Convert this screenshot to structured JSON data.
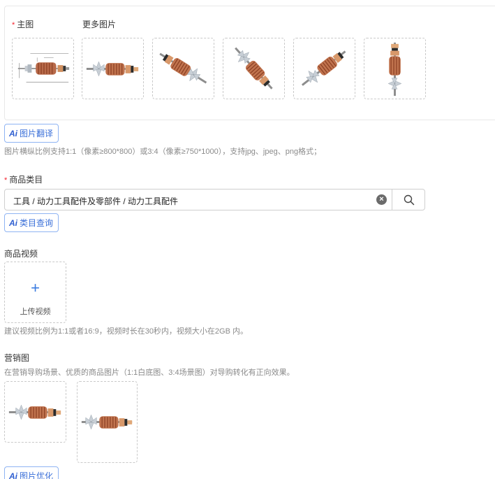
{
  "main_images": {
    "main_label": "主图",
    "required_mark": "*",
    "more_label": "更多图片",
    "thumbnails": [
      {
        "icon": "armature-diagram-image"
      },
      {
        "icon": "armature-side-image"
      },
      {
        "icon": "armature-tilted-image"
      },
      {
        "icon": "armature-diagonal-image"
      },
      {
        "icon": "armature-angled-image"
      },
      {
        "icon": "armature-vertical-image"
      }
    ]
  },
  "ai_translate": {
    "badge": "Ai",
    "label": "图片翻译"
  },
  "image_hint": "图片横纵比例支持1:1（像素≥800*800）或3:4（像素≥750*1000），支持jpg、jpeg、png格式；",
  "category": {
    "required_mark": "*",
    "label": "商品类目",
    "value": "工具 / 动力工具配件及零部件 / 动力工具配件",
    "clear_icon": "clear-icon",
    "search_icon": "search-icon"
  },
  "ai_category": {
    "badge": "Ai",
    "label": "类目查询"
  },
  "video": {
    "label": "商品视频",
    "plus": "+",
    "upload_label": "上传视频",
    "hint": "建议视频比例为1:1或者16:9，视频时长在30秒内，视频大小在2GB 内。"
  },
  "marketing": {
    "label": "营销图",
    "hint": "在营销导购场景、优质的商品图片（1:1白底图、3:4场景图）对导购转化有正向效果。",
    "images": [
      {
        "icon": "armature-square-image"
      },
      {
        "icon": "armature-portrait-image"
      }
    ]
  },
  "ai_optimize": {
    "badge": "Ai",
    "label": "图片优化"
  }
}
